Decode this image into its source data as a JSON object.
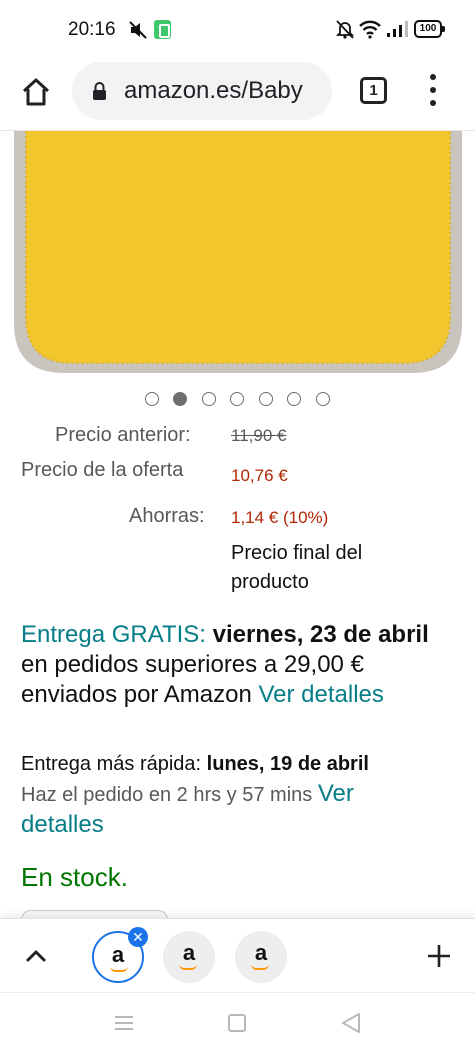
{
  "status_bar": {
    "time": "20:16",
    "battery": "100"
  },
  "browser": {
    "url": "amazon.es/Baby",
    "tab_count": "1",
    "home_label": "home-icon",
    "menu_label": "more-vert-icon"
  },
  "gallery": {
    "image_count": 7,
    "active_index": 1,
    "image_colors": {
      "towel": "#f2c72d",
      "border": "#c9c4bd"
    }
  },
  "price": {
    "previous_label": "Precio anterior:",
    "previous_value": "11,90 €",
    "deal_label": "Precio de la oferta",
    "deal_value": "10,76 €",
    "saving_label": "Ahorras:",
    "saving_value": "1,14 € (10%)",
    "final_note": "Precio final del producto"
  },
  "delivery": {
    "free_label": "Entrega GRATIS:",
    "date": "viernes, 23 de abril",
    "condition": "en pedidos superiores a 29,00 € enviados por Amazon",
    "details_link": "Ver detalles"
  },
  "fast_delivery": {
    "label": "Entrega más rápida:",
    "date": "lunes, 19 de abril",
    "order_by": "Haz el pedido en 2 hrs y 57 mins",
    "details_link": "Ver detalles"
  },
  "stock": {
    "status": "En stock."
  },
  "tab_strip": {
    "tabs": [
      {
        "icon_letter": "a",
        "active": true
      },
      {
        "icon_letter": "a",
        "active": false
      },
      {
        "icon_letter": "a",
        "active": false
      }
    ],
    "close_glyph": "✕"
  },
  "colors": {
    "price_red": "#b12704",
    "link_teal": "#067d87",
    "stock_green": "#007600",
    "active_tab_blue": "#1a73e8"
  }
}
